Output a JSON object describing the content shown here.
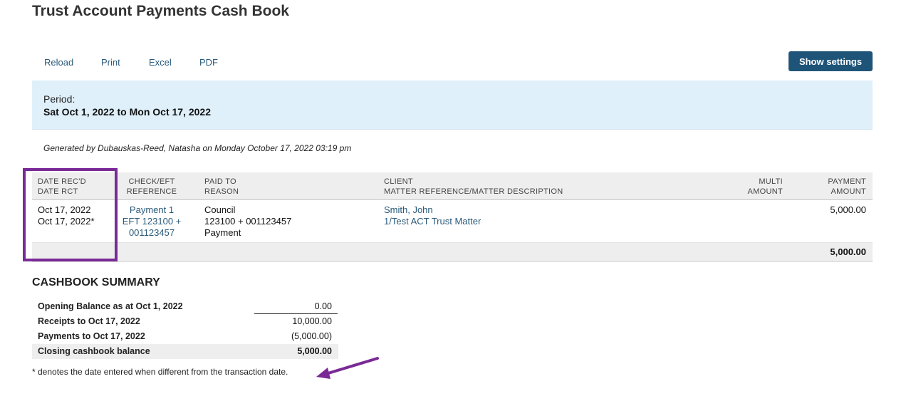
{
  "page": {
    "title": "Trust Account Payments Cash Book"
  },
  "toolbar": {
    "reload_label": "Reload",
    "print_label": "Print",
    "excel_label": "Excel",
    "pdf_label": "PDF",
    "settings_label": "Show settings"
  },
  "period": {
    "label": "Period:",
    "value": "Sat Oct 1, 2022 to Mon Oct 17, 2022"
  },
  "generated": "Generated by Dubauskas-Reed, Natasha on Monday October 17, 2022 03:19 pm",
  "table": {
    "headers": {
      "date": [
        "DATE REC'D",
        "DATE RCT"
      ],
      "check": [
        "CHECK/EFT",
        "REFERENCE"
      ],
      "paid": [
        "PAID TO",
        "REASON"
      ],
      "client": [
        "CLIENT",
        "MATTER REFERENCE/MATTER DESCRIPTION"
      ],
      "multi": [
        "MULTI",
        "AMOUNT"
      ],
      "payment": [
        "PAYMENT",
        "AMOUNT"
      ]
    },
    "rows": [
      {
        "date_recd": "Oct 17, 2022",
        "date_rct": "Oct 17, 2022*",
        "check_ref": "Payment 1",
        "eft_ref_1": "EFT 123100 +",
        "eft_ref_2": "001123457",
        "paid_to": "Council",
        "reference": "123100 + 001123457",
        "reason": "Payment",
        "client": "Smith, John",
        "matter": "1/Test ACT Trust Matter",
        "multi_amount": "",
        "payment_amount": "5,000.00"
      }
    ],
    "total": "5,000.00"
  },
  "summary": {
    "title": "CASHBOOK SUMMARY",
    "rows": [
      {
        "label": "Opening Balance as at Oct 1, 2022",
        "amount": "0.00"
      },
      {
        "label": "Receipts to Oct 17, 2022",
        "amount": "10,000.00"
      },
      {
        "label": "Payments to Oct 17, 2022",
        "amount": "(5,000.00)"
      },
      {
        "label": "Closing cashbook balance",
        "amount": "5,000.00"
      }
    ]
  },
  "footnote": "* denotes the date entered when different from the transaction date.",
  "colors": {
    "accent": "#1f5479",
    "link": "#2a5a7a",
    "period_bg": "#dff0fb",
    "annotation": "#7a2a96"
  }
}
